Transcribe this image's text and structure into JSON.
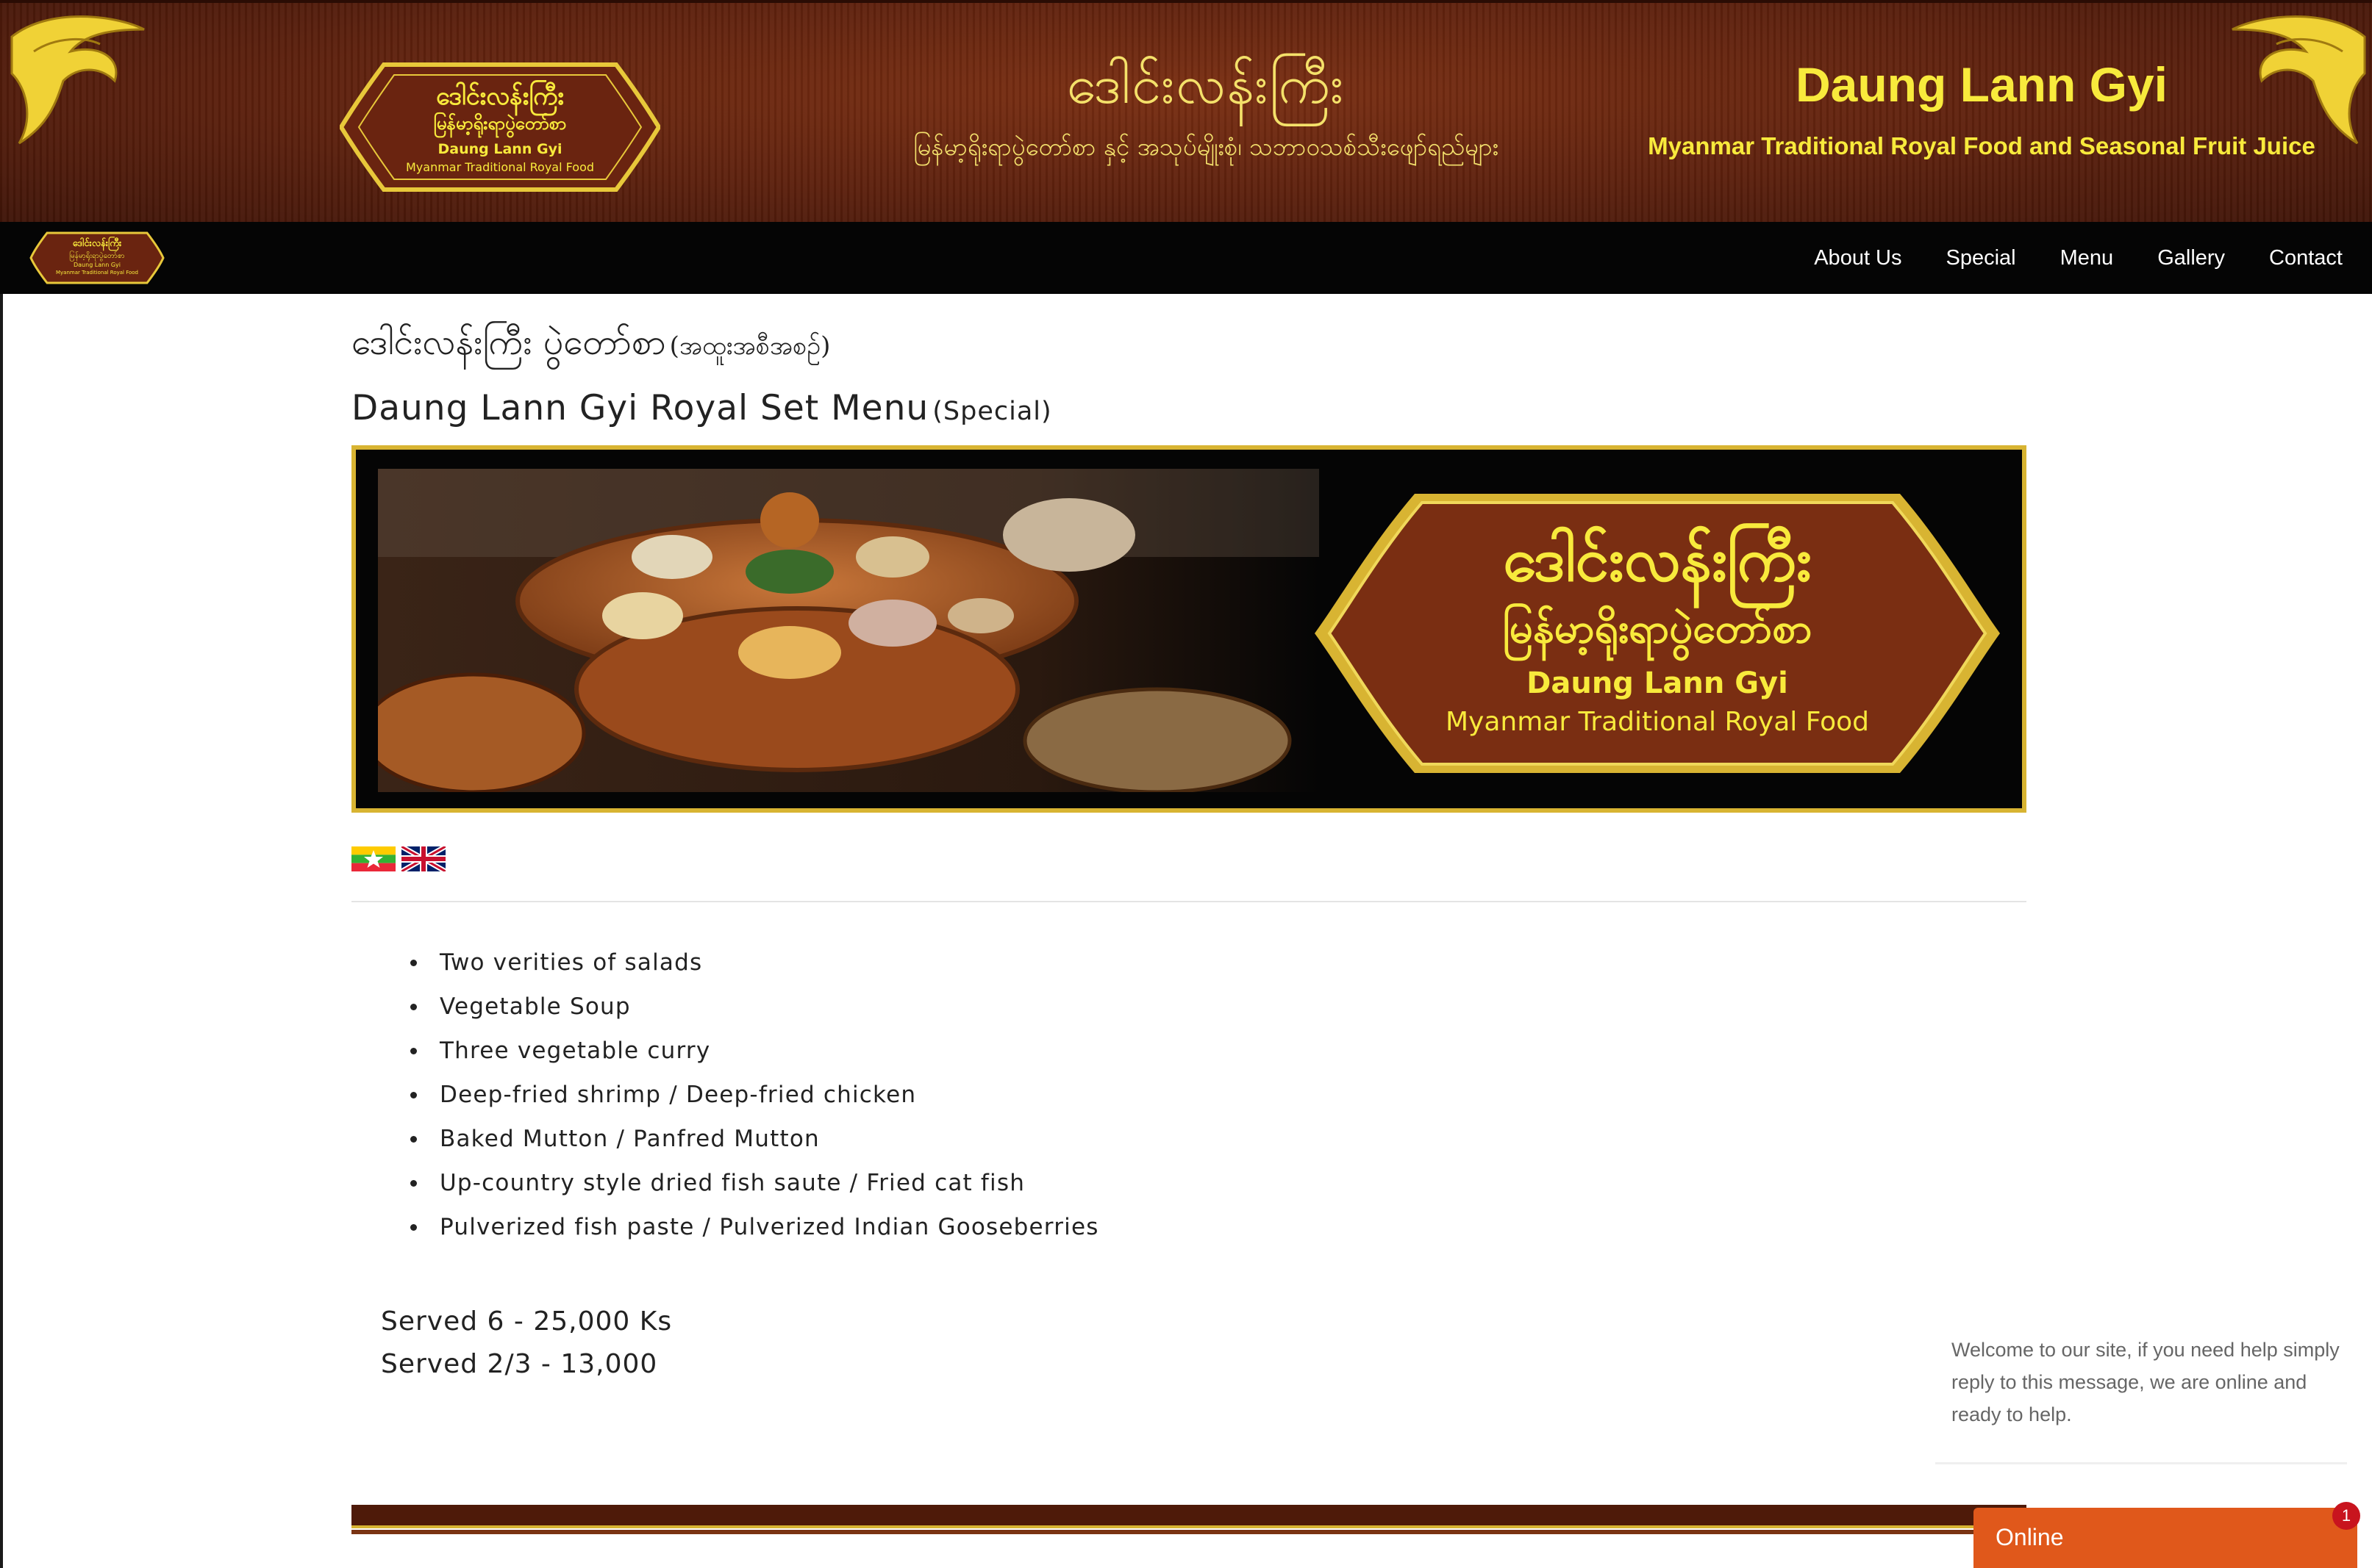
{
  "banner": {
    "logo": {
      "mm_title": "ဒေါင်းလန်းကြီး",
      "mm_sub": "မြန်မာ့ရိုးရာပွဲတော်စာ",
      "en_title": "Daung Lann Gyi",
      "en_sub": "Myanmar Traditional Royal Food"
    },
    "mm_title": "ဒေါင်းလန်းကြီး",
    "mm_subtitle": "မြန်မာ့ရိုးရာပွဲတော်စာ နှင့် အသုပ်မျိုးစုံ၊ သဘာဝသစ်သီးဖျော်ရည်များ",
    "en_title": "Daung Lann Gyi",
    "en_subtitle": "Myanmar Traditional Royal Food and Seasonal Fruit Juice"
  },
  "nav": {
    "logo": {
      "mm_title": "ဒေါင်းလန်းကြီး",
      "mm_sub": "မြန်မာ့ရိုးရာပွဲတော်စာ",
      "en_title": "Daung Lann Gyi",
      "en_sub": "Myanmar Traditional Royal Food"
    },
    "items": [
      {
        "label": "About Us"
      },
      {
        "label": "Special"
      },
      {
        "label": "Menu"
      },
      {
        "label": "Gallery"
      },
      {
        "label": "Contact"
      }
    ]
  },
  "main": {
    "mm_heading": "ဒေါင်းလန်းကြီး ပွဲတော်စာ",
    "mm_heading_suffix": "(အထူးအစီအစဉ်)",
    "en_heading": "Daung Lann Gyi Royal Set Menu",
    "en_heading_suffix": "(Special)",
    "hero": {
      "mm_title": "ဒေါင်းလန်းကြီး",
      "mm_sub": "မြန်မာ့ရိုးရာပွဲတော်စာ",
      "en_title": "Daung Lann Gyi",
      "en_sub": "Myanmar Traditional Royal Food"
    },
    "languages": [
      {
        "name": "Myanmar",
        "icon": "myanmar-flag-icon"
      },
      {
        "name": "English",
        "icon": "uk-flag-icon"
      }
    ],
    "items": [
      "Two verities of salads",
      "Vegetable Soup",
      "Three vegetable curry",
      "Deep-fried shrimp / Deep-fried chicken",
      "Baked Mutton / Panfred Mutton",
      "Up-country style dried fish saute / Fried cat fish",
      "Pulverized fish paste / Pulverized Indian Gooseberries"
    ],
    "prices": [
      "Served 6 - 25,000 Ks",
      "Served 2/3 - 13,000"
    ]
  },
  "chat": {
    "message": "Welcome to our site, if you need help simply reply to this message, we are online and ready to help.",
    "status": "Online",
    "badge_count": "1"
  },
  "colors": {
    "banner_brown": "#5c200d",
    "gold": "#d8b432",
    "yellow_text": "#f8ea3c",
    "nav_black": "#050505",
    "chat_orange": "#e0581b",
    "badge_red": "#c8141e"
  }
}
